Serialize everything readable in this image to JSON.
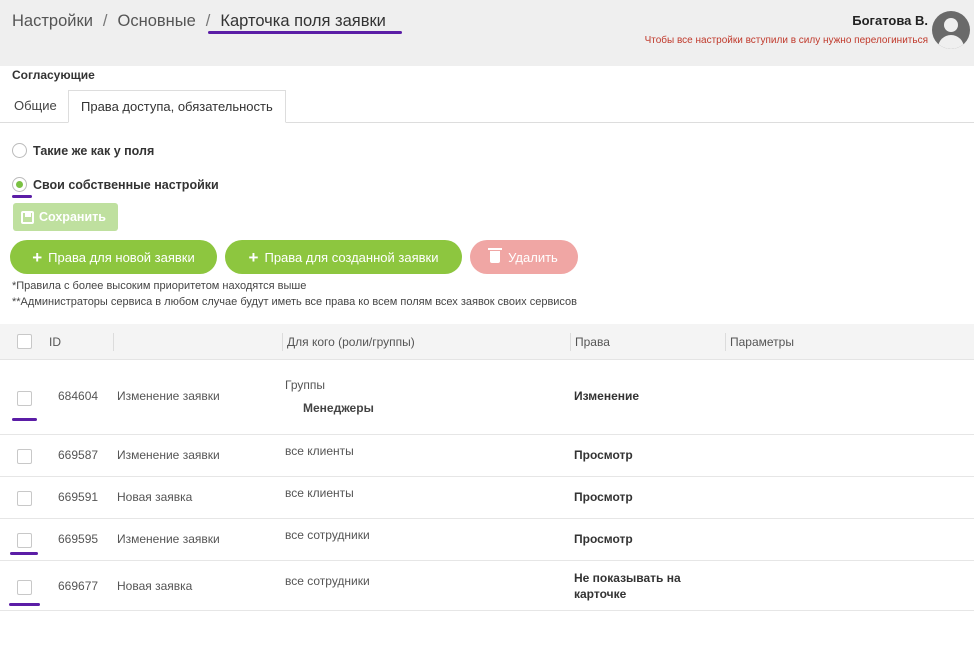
{
  "header": {
    "breadcrumb": [
      "Настройки",
      "Основные",
      "Карточка поля заявки"
    ],
    "separator": "/",
    "user_name": "Богатова В.",
    "relogin_notice": "Чтобы все настройки вступили в силу нужно перелогиниться"
  },
  "section_title": "Согласующие",
  "tabs": [
    {
      "label": "Общие",
      "active": false
    },
    {
      "label": "Права доступа, обязательность",
      "active": true
    }
  ],
  "radios": [
    {
      "label": "Такие же как у поля",
      "checked": false
    },
    {
      "label": "Свои собственные настройки",
      "checked": true
    }
  ],
  "buttons": {
    "save": "Сохранить",
    "add_new": "Права для новой заявки",
    "add_created": "Права для созданной заявки",
    "delete": "Удалить"
  },
  "notes": [
    "*Правила с более высоким приоритетом находятся выше",
    "**Администраторы сервиса в любом случае будут иметь все права ко всем полям всех заявок своих сервисов"
  ],
  "table": {
    "columns": [
      "ID",
      "",
      "Для кого (роли/группы)",
      "Права",
      "Параметры"
    ],
    "rows": [
      {
        "id": "684604",
        "type": "Изменение заявки",
        "who": "Группы",
        "who_detail": "Менеджеры",
        "rights": "Изменение",
        "params": ""
      },
      {
        "id": "669587",
        "type": "Изменение заявки",
        "who": "все клиенты",
        "who_detail": "",
        "rights": "Просмотр",
        "params": ""
      },
      {
        "id": "669591",
        "type": "Новая заявка",
        "who": "все клиенты",
        "who_detail": "",
        "rights": "Просмотр",
        "params": ""
      },
      {
        "id": "669595",
        "type": "Изменение заявки",
        "who": "все сотрудники",
        "who_detail": "",
        "rights": "Просмотр",
        "params": ""
      },
      {
        "id": "669677",
        "type": "Новая заявка",
        "who": "все сотрудники",
        "who_detail": "",
        "rights": "Не показывать на карточке",
        "params": ""
      }
    ]
  },
  "colors": {
    "accent_green": "#8dc63f",
    "save_disabled": "#bfe09f",
    "delete_disabled": "#f0a6a4",
    "annotation_underline": "#5b1da6",
    "warning_text": "#c0392b"
  }
}
